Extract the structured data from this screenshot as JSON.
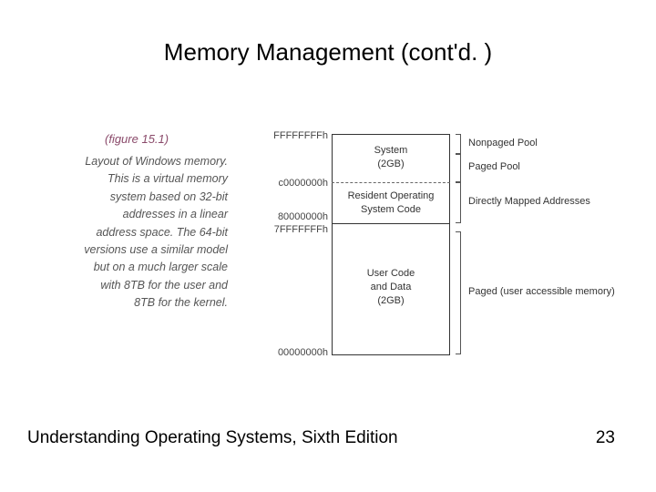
{
  "title": "Memory Management (cont'd. )",
  "figure_label": "(figure 15.1)",
  "caption": "Layout of Windows memory. This is a virtual memory system based on 32-bit addresses in a linear address space. The 64-bit versions use a similar model but on a much larger scale with 8TB for the user and 8TB for the kernel.",
  "addresses": {
    "top": "FFFFFFFFh",
    "c0": "c0000000h",
    "eighty": "80000000h",
    "sevenf": "7FFFFFFFh",
    "bottom": "00000000h"
  },
  "blocks": {
    "system_line1": "System",
    "system_line2": "(2GB)",
    "roc_line1": "Resident Operating",
    "roc_line2": "System Code",
    "user_line1": "User Code",
    "user_line2": "and Data",
    "user_line3": "(2GB)"
  },
  "right_labels": {
    "nonpaged": "Nonpaged Pool",
    "paged_pool": "Paged Pool",
    "directly": "Directly Mapped Addresses",
    "user_paged": "Paged (user accessible memory)"
  },
  "footer": {
    "left": "Understanding Operating Systems, Sixth Edition",
    "right": "23"
  }
}
